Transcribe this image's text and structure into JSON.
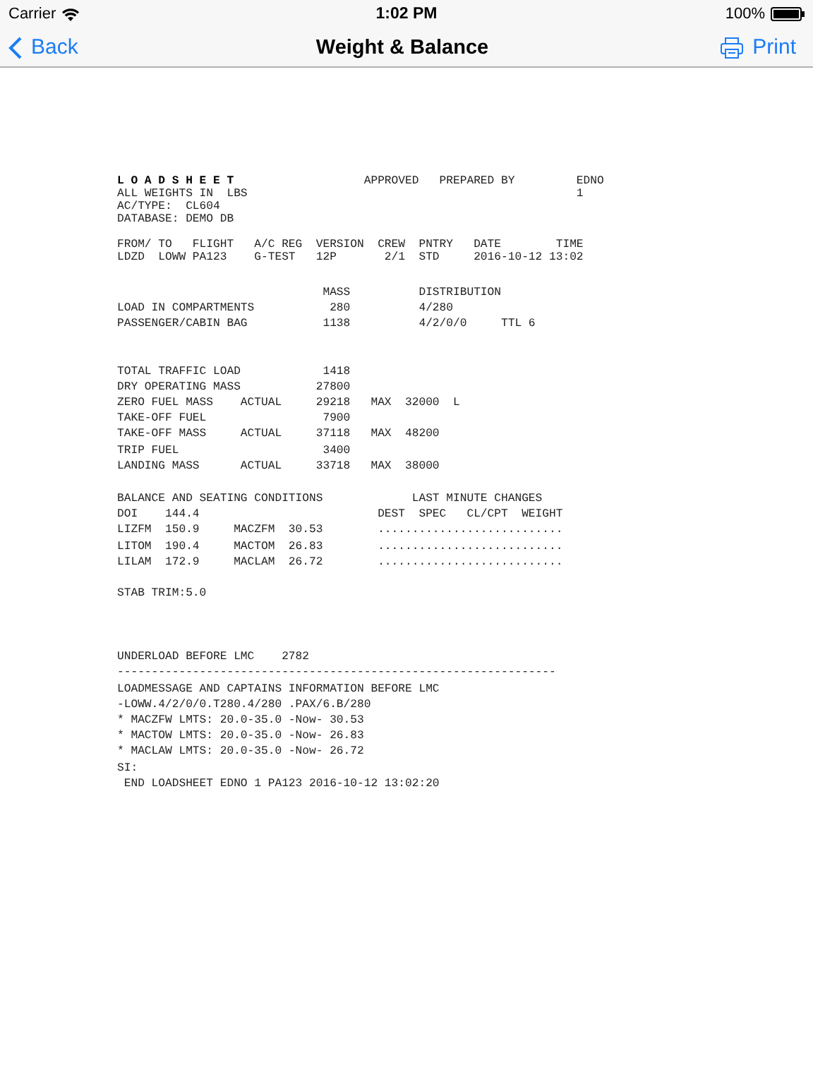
{
  "status_bar": {
    "carrier": "Carrier",
    "time": "1:02 PM",
    "battery": "100%"
  },
  "nav_bar": {
    "back": "Back",
    "title": "Weight & Balance",
    "action": "Print"
  },
  "loadsheet": {
    "blocks": [
      {
        "kind": "compact",
        "lines": [
          "**L O A D S H E E T**                   APPROVED   PREPARED BY         EDNO",
          "ALL WEIGHTS IN  LBS                                                1",
          "AC/TYPE:  CL604",
          "DATABASE: DEMO DB"
        ]
      },
      {
        "kind": "compact",
        "lines": [
          "FROM/ TO   FLIGHT   A/C REG  VERSION  CREW  PNTRY   DATE        TIME",
          "LDZD  LOWW PA123    G-TEST   12P       2/1  STD     2016-10-12 13:02"
        ]
      },
      {
        "kind": "normal",
        "lines": [
          "                              MASS          DISTRIBUTION",
          "LOAD IN COMPARTMENTS           280          4/280",
          "PASSENGER/CABIN BAG           1138          4/2/0/0     TTL 6"
        ]
      },
      {
        "kind": "normal",
        "lines": [
          "TOTAL TRAFFIC LOAD            1418",
          "DRY OPERATING MASS           27800",
          "ZERO FUEL MASS    ACTUAL     29218   MAX  32000  L",
          "TAKE-OFF FUEL                 7900",
          "TAKE-OFF MASS     ACTUAL     37118   MAX  48200",
          "TRIP FUEL                     3400",
          "LANDING MASS      ACTUAL     33718   MAX  38000"
        ]
      },
      {
        "kind": "normal",
        "lines": [
          "BALANCE AND SEATING CONDITIONS             LAST MINUTE CHANGES",
          "DOI    144.4                          DEST  SPEC   CL/CPT  WEIGHT",
          "LIZFM  150.9     MACZFM  30.53        ...........................",
          "LITOM  190.4     MACTOM  26.83        ...........................",
          "LILAM  172.9     MACLAM  26.72        ..........................."
        ]
      },
      {
        "kind": "normal",
        "lines": [
          "STAB TRIM:5.0"
        ]
      },
      {
        "kind": "normal",
        "lines": [
          "UNDERLOAD BEFORE LMC    2782",
          "----------------------------------------------------------------",
          "LOADMESSAGE AND CAPTAINS INFORMATION BEFORE LMC",
          "-LOWW.4/2/0/0.T280.4/280 .PAX/6.B/280",
          "* MACZFW LMTS: 20.0-35.0 -Now- 30.53",
          "* MACTOW LMTS: 20.0-35.0 -Now- 26.83",
          "* MACLAW LMTS: 20.0-35.0 -Now- 26.72",
          "SI:",
          " END LOADSHEET EDNO 1 PA123 2016-10-12 13:02:20"
        ]
      }
    ]
  }
}
